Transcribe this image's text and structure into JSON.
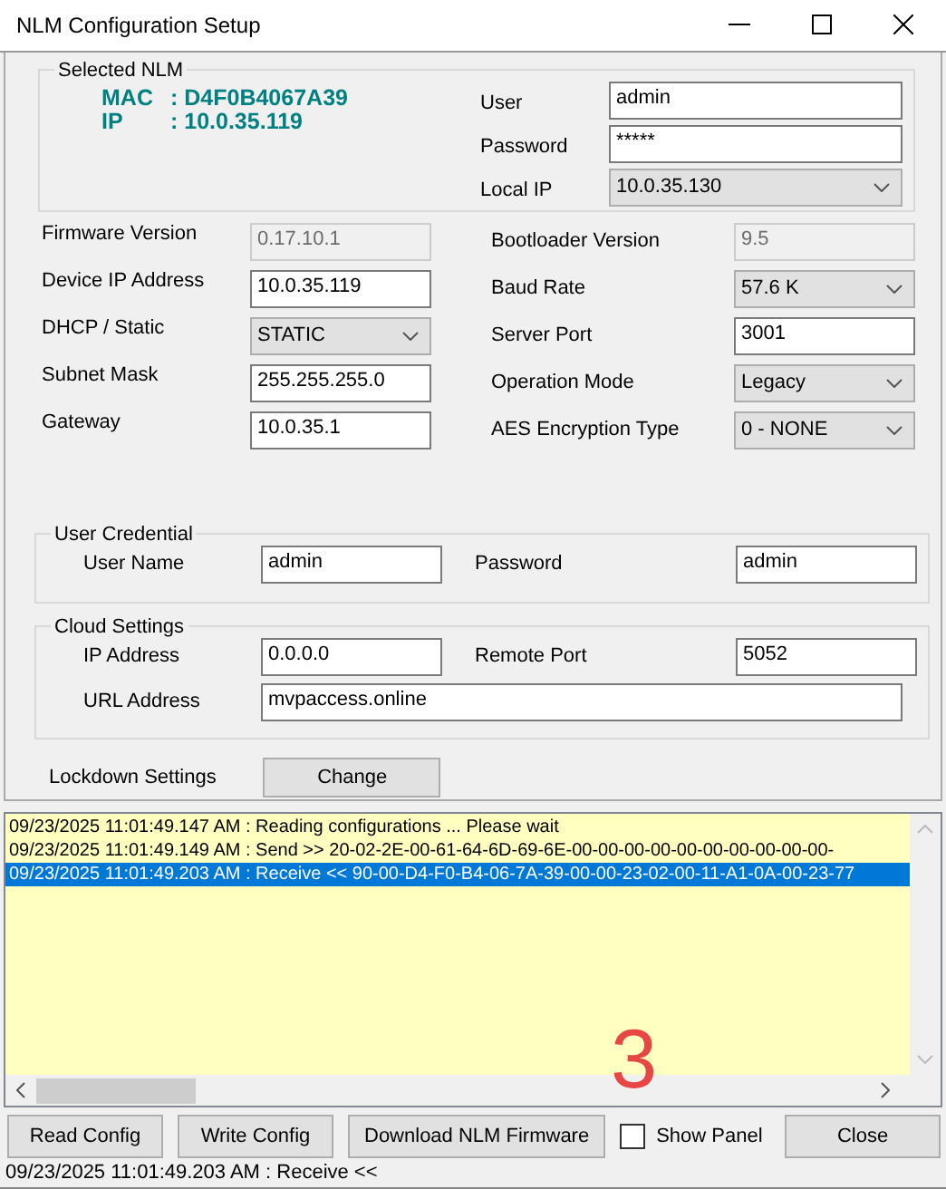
{
  "window": {
    "title": "NLM Configuration Setup"
  },
  "selected_nlm": {
    "legend": "Selected NLM",
    "mac_label": "MAC",
    "mac": ": D4F0B4067A39",
    "ip_label": "IP",
    "ip": ": 10.0.35.119",
    "fields": [
      {
        "label": "User",
        "kind": "text",
        "value": "admin"
      },
      {
        "label": "Password",
        "kind": "text",
        "value": "*****"
      },
      {
        "label": "Local IP",
        "kind": "select",
        "value": "10.0.35.130"
      }
    ]
  },
  "device_settings": {
    "left": [
      {
        "label": "Firmware Version",
        "kind": "text",
        "value": "0.17.10.1",
        "disabled": true
      },
      {
        "label": "Device IP Address",
        "kind": "text",
        "value": "10.0.35.119",
        "disabled": false
      },
      {
        "label": "DHCP / Static",
        "kind": "select",
        "value": "STATIC",
        "disabled": false
      },
      {
        "label": "Subnet Mask",
        "kind": "text",
        "value": "255.255.255.0",
        "disabled": false
      },
      {
        "label": "Gateway",
        "kind": "text",
        "value": "10.0.35.1",
        "disabled": false
      }
    ],
    "right": [
      {
        "label": "Bootloader Version",
        "kind": "text",
        "value": "9.5",
        "disabled": true
      },
      {
        "label": "Baud Rate",
        "kind": "select",
        "value": "57.6 K",
        "disabled": false
      },
      {
        "label": "Server Port",
        "kind": "text",
        "value": "3001",
        "disabled": false
      },
      {
        "label": "Operation Mode",
        "kind": "select",
        "value": "Legacy",
        "disabled": false
      },
      {
        "label": "AES Encryption Type",
        "kind": "select",
        "value": "0 - NONE",
        "disabled": false
      }
    ]
  },
  "user_credential": {
    "legend": "User Credential",
    "fields": [
      {
        "label": "User Name",
        "value": "admin"
      },
      {
        "label": "Password",
        "value": "admin"
      }
    ]
  },
  "cloud_settings": {
    "legend": "Cloud Settings",
    "fields": [
      {
        "label": "IP Address",
        "value": "0.0.0.0"
      },
      {
        "label": "Remote Port",
        "value": "5052"
      }
    ],
    "url_label": "URL Address",
    "url": "mvpaccess.online"
  },
  "lockdown": {
    "label": "Lockdown Settings",
    "button": "Change"
  },
  "log": {
    "lines": [
      {
        "text": "09/23/2025 11:01:49.147 AM : Reading configurations ... Please wait",
        "selected": false
      },
      {
        "text": "09/23/2025 11:01:49.149 AM : Send >> 20-02-2E-00-61-64-6D-69-6E-00-00-00-00-00-00-00-00-00-00-",
        "selected": false
      },
      {
        "text": "09/23/2025 11:01:49.203 AM : Receive << 90-00-D4-F0-B4-06-7A-39-00-00-23-02-00-11-A1-0A-00-23-77",
        "selected": true
      }
    ]
  },
  "annotation": "3",
  "footer": [
    {
      "kind": "button",
      "label": "Read Config"
    },
    {
      "kind": "button",
      "label": "Write Config"
    },
    {
      "kind": "button",
      "label": "Download NLM Firmware"
    },
    {
      "kind": "checkbox",
      "label": "Show Panel",
      "checked": false
    },
    {
      "kind": "button",
      "label": "Close"
    }
  ],
  "status_bar": "09/23/2025 11:01:49.203 AM : Receive <<"
}
